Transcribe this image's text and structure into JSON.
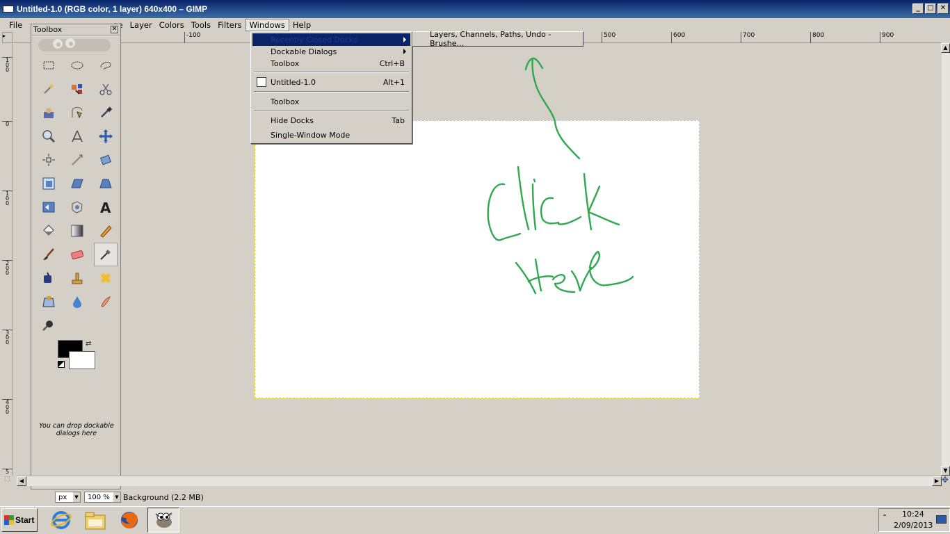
{
  "window": {
    "title": "Untitled-1.0 (RGB color, 1 layer) 640x400 – GIMP"
  },
  "menubar": {
    "items": [
      "File",
      "ge",
      "Layer",
      "Colors",
      "Tools",
      "Filters",
      "Windows",
      "Help"
    ]
  },
  "toolbox": {
    "title": "Toolbox",
    "drop_hint": "You can drop dockable dialogs here"
  },
  "windows_menu": {
    "recently_closed": "Recently Closed Docks",
    "dockable_dialogs": "Dockable Dialogs",
    "toolbox": "Toolbox",
    "toolbox_accel": "Ctrl+B",
    "untitled": "Untitled-1.0",
    "untitled_accel": "Alt+1",
    "toolbox2": "Toolbox",
    "hide_docks": "Hide Docks",
    "hide_docks_accel": "Tab",
    "single_window": "Single-Window Mode"
  },
  "submenu": {
    "item": "Layers, Channels, Paths, Undo - Brushe..."
  },
  "hruler": {
    "labels": [
      "-100",
      "500",
      "600",
      "700",
      "800",
      "900"
    ]
  },
  "vruler": {
    "labels": [
      "100",
      "0",
      "100",
      "200",
      "300",
      "400",
      "5"
    ]
  },
  "annotation": {
    "text": "Click here"
  },
  "statusbar": {
    "unit": "px",
    "zoom": "100 %",
    "layer_info": "Background (2.2 MB)"
  },
  "taskbar": {
    "start": "Start",
    "time": "10:24",
    "date": "2/09/2013"
  },
  "colors": {
    "annotation": "#2fa84f",
    "menu_highlight": "#0a246a"
  }
}
